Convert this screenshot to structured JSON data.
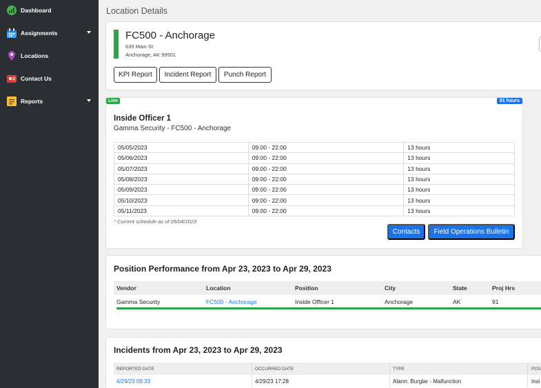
{
  "sidebar": {
    "items": [
      {
        "label": "Dashboard",
        "icon": "dashboard-icon",
        "color": "#4caf50"
      },
      {
        "label": "Assignments",
        "icon": "calendar-icon",
        "color": "#42a5f5"
      },
      {
        "label": "Locations",
        "icon": "location-pin-icon",
        "color": "#ab47bc"
      },
      {
        "label": "Contact Us",
        "icon": "contact-icon",
        "color": "#e53935"
      },
      {
        "label": "Reports",
        "icon": "reports-icon",
        "color": "#fbc02d"
      }
    ]
  },
  "page": {
    "title": "Location Details"
  },
  "location": {
    "title": "FC500 - Anchorage",
    "address1": "639 Main St",
    "address2": "Anchorage, AK 99501",
    "buttons": {
      "kpi": "KPI Report",
      "incident": "Incident Report",
      "punch": "Punch Report"
    }
  },
  "position": {
    "live_badge": "Live",
    "hours_badge": "91 hours",
    "officer": "Inside Officer 1",
    "vendor_line": "Gamma Security - FC500 - Anchorage",
    "schedule": [
      {
        "date": "05/05/2023",
        "time": "09:00 - 22:00",
        "hours": "13 hours"
      },
      {
        "date": "05/06/2023",
        "time": "09:00 - 22:00",
        "hours": "13 hours"
      },
      {
        "date": "05/07/2023",
        "time": "09:00 - 22:00",
        "hours": "13 hours"
      },
      {
        "date": "05/08/2023",
        "time": "09:00 - 22:00",
        "hours": "13 hours"
      },
      {
        "date": "05/09/2023",
        "time": "09:00 - 22:00",
        "hours": "13 hours"
      },
      {
        "date": "05/10/2023",
        "time": "09:00 - 22:00",
        "hours": "13 hours"
      },
      {
        "date": "05/11/2023",
        "time": "09:00 - 22:00",
        "hours": "13 hours"
      }
    ],
    "note": "* Current schedule as of 05/04/2023",
    "contacts_label": "Contacts",
    "bulletin_label": "Field Operations Bulletin"
  },
  "performance": {
    "title": "Position Performance from Apr 23, 2023 to Apr 29, 2023",
    "headers": [
      "Vendor",
      "Location",
      "Position",
      "City",
      "State",
      "Proj Hrs"
    ],
    "row": {
      "vendor": "Gamma Security",
      "location": "FC500 - Anchorage",
      "position": "Inside Officer 1",
      "city": "Anchorage",
      "state": "AK",
      "proj_hrs": "91"
    }
  },
  "incidents": {
    "title": "Incidents from Apr 23, 2023 to Apr 29, 2023",
    "headers": [
      "REPORTED DATE",
      "OCCURRED DATE",
      "TYPE",
      "POS"
    ],
    "row": {
      "reported": "4/29/23 09:33",
      "occurred": "4/29/23 17:28",
      "type": "Alarm: Burglar - Malfunction",
      "pos": "Insi"
    }
  },
  "colors": {
    "sidebar": "#2b2f33",
    "accent": "#1a73e8",
    "success": "#28a745"
  }
}
